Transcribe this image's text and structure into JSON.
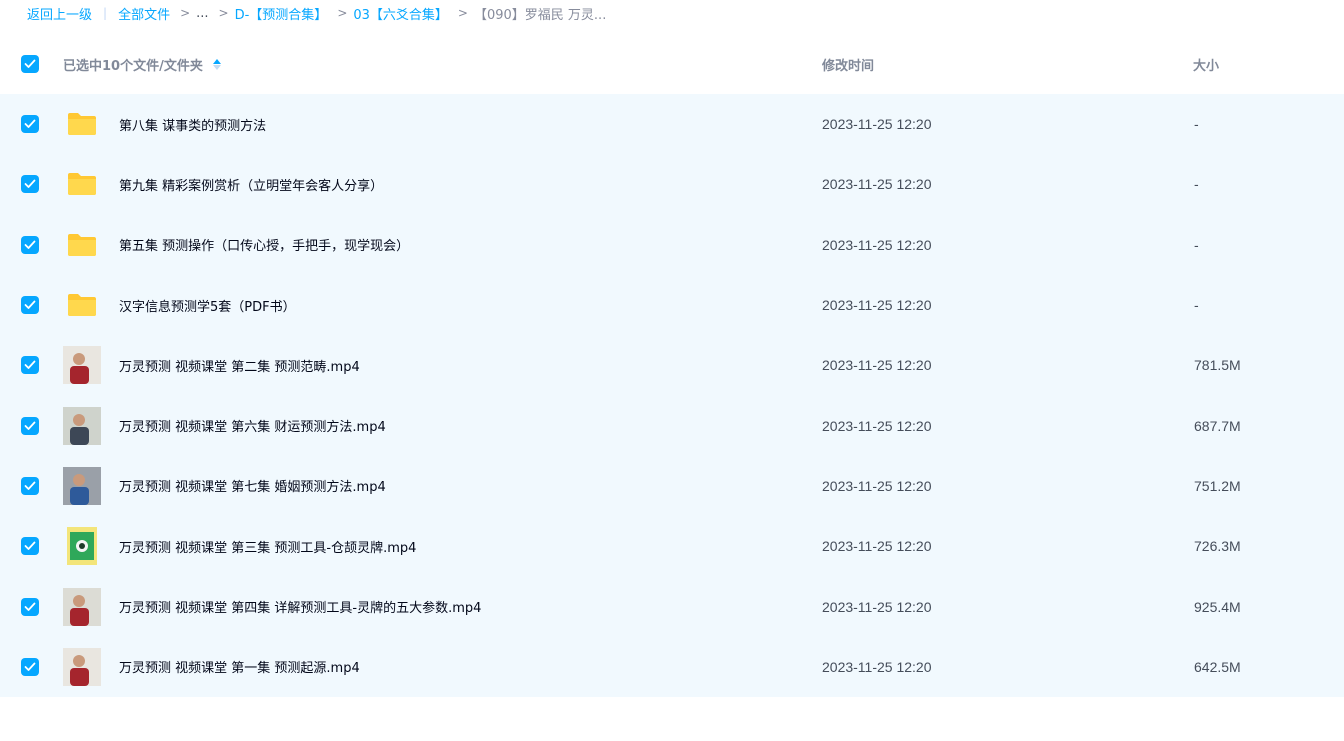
{
  "breadcrumb": {
    "back": "返回上一级",
    "separator_bar": "|",
    "all_files": "全部文件",
    "separator": ">",
    "ellipsis": "...",
    "level1": "D-【预测合集】",
    "level2": "03【六爻合集】",
    "current": "【090】罗福民 万灵..."
  },
  "header": {
    "selected_label": "已选中10个文件/文件夹",
    "time_label": "修改时间",
    "size_label": "大小"
  },
  "colors": {
    "accent": "#06a7ff",
    "row_bg": "#f1f9fe",
    "folder": "#ffc833"
  },
  "files": [
    {
      "type": "folder",
      "icon": "folder-icon",
      "name": "第八集 谋事类的预测方法",
      "time": "2023-11-25 12:20",
      "size": "-"
    },
    {
      "type": "folder",
      "icon": "folder-icon",
      "name": "第九集 精彩案例赏析（立明堂年会客人分享）",
      "time": "2023-11-25 12:20",
      "size": "-"
    },
    {
      "type": "folder",
      "icon": "folder-icon",
      "name": "第五集 预测操作（口传心授，手把手，现学现会）",
      "time": "2023-11-25 12:20",
      "size": "-"
    },
    {
      "type": "folder",
      "icon": "folder-icon",
      "name": "汉字信息预测学5套（PDF书）",
      "time": "2023-11-25 12:20",
      "size": "-"
    },
    {
      "type": "video",
      "icon": "video-thumbnail",
      "thumb": "speaker-red",
      "name": "万灵预测 视频课堂 第二集 预测范畴.mp4",
      "time": "2023-11-25 12:20",
      "size": "781.5M"
    },
    {
      "type": "video",
      "icon": "video-thumbnail",
      "thumb": "whiteboard",
      "name": "万灵预测 视频课堂 第六集 财运预测方法.mp4",
      "time": "2023-11-25 12:20",
      "size": "687.7M"
    },
    {
      "type": "video",
      "icon": "video-thumbnail",
      "thumb": "speaker-blue",
      "name": "万灵预测 视频课堂 第七集 婚姻预测方法.mp4",
      "time": "2023-11-25 12:20",
      "size": "751.2M"
    },
    {
      "type": "video",
      "icon": "video-thumbnail",
      "thumb": "card",
      "name": "万灵预测 视频课堂 第三集 预测工具-仓颉灵牌.mp4",
      "time": "2023-11-25 12:20",
      "size": "726.3M"
    },
    {
      "type": "video",
      "icon": "video-thumbnail",
      "thumb": "speaker-light",
      "name": "万灵预测 视频课堂 第四集 详解预测工具-灵牌的五大参数.mp4",
      "time": "2023-11-25 12:20",
      "size": "925.4M"
    },
    {
      "type": "video",
      "icon": "video-thumbnail",
      "thumb": "speaker-red",
      "name": "万灵预测 视频课堂 第一集 预测起源.mp4",
      "time": "2023-11-25 12:20",
      "size": "642.5M"
    }
  ]
}
